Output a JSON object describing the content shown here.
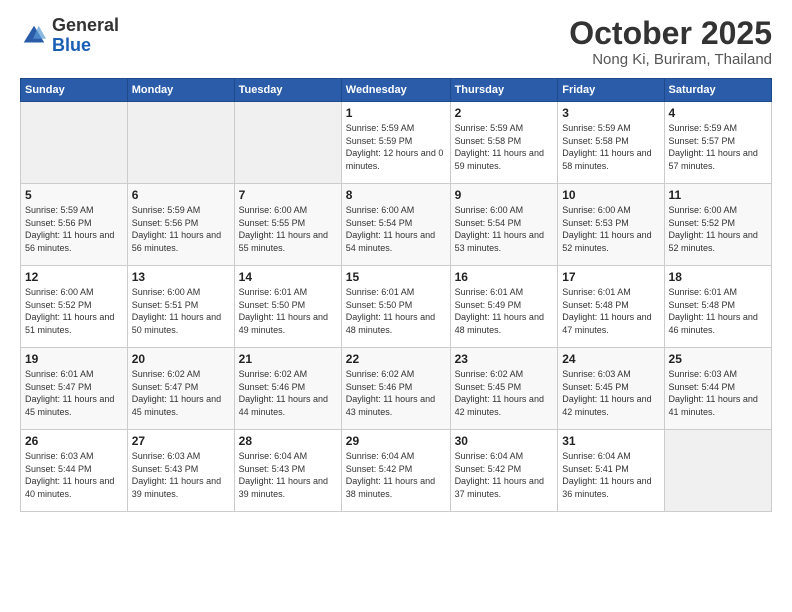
{
  "header": {
    "logo_general": "General",
    "logo_blue": "Blue",
    "month_title": "October 2025",
    "location": "Nong Ki, Buriram, Thailand"
  },
  "weekdays": [
    "Sunday",
    "Monday",
    "Tuesday",
    "Wednesday",
    "Thursday",
    "Friday",
    "Saturday"
  ],
  "weeks": [
    [
      {
        "day": "",
        "sunrise": "",
        "sunset": "",
        "daylight": "",
        "empty": true
      },
      {
        "day": "",
        "sunrise": "",
        "sunset": "",
        "daylight": "",
        "empty": true
      },
      {
        "day": "",
        "sunrise": "",
        "sunset": "",
        "daylight": "",
        "empty": true
      },
      {
        "day": "1",
        "sunrise": "Sunrise: 5:59 AM",
        "sunset": "Sunset: 5:59 PM",
        "daylight": "Daylight: 12 hours and 0 minutes."
      },
      {
        "day": "2",
        "sunrise": "Sunrise: 5:59 AM",
        "sunset": "Sunset: 5:58 PM",
        "daylight": "Daylight: 11 hours and 59 minutes."
      },
      {
        "day": "3",
        "sunrise": "Sunrise: 5:59 AM",
        "sunset": "Sunset: 5:58 PM",
        "daylight": "Daylight: 11 hours and 58 minutes."
      },
      {
        "day": "4",
        "sunrise": "Sunrise: 5:59 AM",
        "sunset": "Sunset: 5:57 PM",
        "daylight": "Daylight: 11 hours and 57 minutes."
      }
    ],
    [
      {
        "day": "5",
        "sunrise": "Sunrise: 5:59 AM",
        "sunset": "Sunset: 5:56 PM",
        "daylight": "Daylight: 11 hours and 56 minutes."
      },
      {
        "day": "6",
        "sunrise": "Sunrise: 5:59 AM",
        "sunset": "Sunset: 5:56 PM",
        "daylight": "Daylight: 11 hours and 56 minutes."
      },
      {
        "day": "7",
        "sunrise": "Sunrise: 6:00 AM",
        "sunset": "Sunset: 5:55 PM",
        "daylight": "Daylight: 11 hours and 55 minutes."
      },
      {
        "day": "8",
        "sunrise": "Sunrise: 6:00 AM",
        "sunset": "Sunset: 5:54 PM",
        "daylight": "Daylight: 11 hours and 54 minutes."
      },
      {
        "day": "9",
        "sunrise": "Sunrise: 6:00 AM",
        "sunset": "Sunset: 5:54 PM",
        "daylight": "Daylight: 11 hours and 53 minutes."
      },
      {
        "day": "10",
        "sunrise": "Sunrise: 6:00 AM",
        "sunset": "Sunset: 5:53 PM",
        "daylight": "Daylight: 11 hours and 52 minutes."
      },
      {
        "day": "11",
        "sunrise": "Sunrise: 6:00 AM",
        "sunset": "Sunset: 5:52 PM",
        "daylight": "Daylight: 11 hours and 52 minutes."
      }
    ],
    [
      {
        "day": "12",
        "sunrise": "Sunrise: 6:00 AM",
        "sunset": "Sunset: 5:52 PM",
        "daylight": "Daylight: 11 hours and 51 minutes."
      },
      {
        "day": "13",
        "sunrise": "Sunrise: 6:00 AM",
        "sunset": "Sunset: 5:51 PM",
        "daylight": "Daylight: 11 hours and 50 minutes."
      },
      {
        "day": "14",
        "sunrise": "Sunrise: 6:01 AM",
        "sunset": "Sunset: 5:50 PM",
        "daylight": "Daylight: 11 hours and 49 minutes."
      },
      {
        "day": "15",
        "sunrise": "Sunrise: 6:01 AM",
        "sunset": "Sunset: 5:50 PM",
        "daylight": "Daylight: 11 hours and 48 minutes."
      },
      {
        "day": "16",
        "sunrise": "Sunrise: 6:01 AM",
        "sunset": "Sunset: 5:49 PM",
        "daylight": "Daylight: 11 hours and 48 minutes."
      },
      {
        "day": "17",
        "sunrise": "Sunrise: 6:01 AM",
        "sunset": "Sunset: 5:48 PM",
        "daylight": "Daylight: 11 hours and 47 minutes."
      },
      {
        "day": "18",
        "sunrise": "Sunrise: 6:01 AM",
        "sunset": "Sunset: 5:48 PM",
        "daylight": "Daylight: 11 hours and 46 minutes."
      }
    ],
    [
      {
        "day": "19",
        "sunrise": "Sunrise: 6:01 AM",
        "sunset": "Sunset: 5:47 PM",
        "daylight": "Daylight: 11 hours and 45 minutes."
      },
      {
        "day": "20",
        "sunrise": "Sunrise: 6:02 AM",
        "sunset": "Sunset: 5:47 PM",
        "daylight": "Daylight: 11 hours and 45 minutes."
      },
      {
        "day": "21",
        "sunrise": "Sunrise: 6:02 AM",
        "sunset": "Sunset: 5:46 PM",
        "daylight": "Daylight: 11 hours and 44 minutes."
      },
      {
        "day": "22",
        "sunrise": "Sunrise: 6:02 AM",
        "sunset": "Sunset: 5:46 PM",
        "daylight": "Daylight: 11 hours and 43 minutes."
      },
      {
        "day": "23",
        "sunrise": "Sunrise: 6:02 AM",
        "sunset": "Sunset: 5:45 PM",
        "daylight": "Daylight: 11 hours and 42 minutes."
      },
      {
        "day": "24",
        "sunrise": "Sunrise: 6:03 AM",
        "sunset": "Sunset: 5:45 PM",
        "daylight": "Daylight: 11 hours and 42 minutes."
      },
      {
        "day": "25",
        "sunrise": "Sunrise: 6:03 AM",
        "sunset": "Sunset: 5:44 PM",
        "daylight": "Daylight: 11 hours and 41 minutes."
      }
    ],
    [
      {
        "day": "26",
        "sunrise": "Sunrise: 6:03 AM",
        "sunset": "Sunset: 5:44 PM",
        "daylight": "Daylight: 11 hours and 40 minutes."
      },
      {
        "day": "27",
        "sunrise": "Sunrise: 6:03 AM",
        "sunset": "Sunset: 5:43 PM",
        "daylight": "Daylight: 11 hours and 39 minutes."
      },
      {
        "day": "28",
        "sunrise": "Sunrise: 6:04 AM",
        "sunset": "Sunset: 5:43 PM",
        "daylight": "Daylight: 11 hours and 39 minutes."
      },
      {
        "day": "29",
        "sunrise": "Sunrise: 6:04 AM",
        "sunset": "Sunset: 5:42 PM",
        "daylight": "Daylight: 11 hours and 38 minutes."
      },
      {
        "day": "30",
        "sunrise": "Sunrise: 6:04 AM",
        "sunset": "Sunset: 5:42 PM",
        "daylight": "Daylight: 11 hours and 37 minutes."
      },
      {
        "day": "31",
        "sunrise": "Sunrise: 6:04 AM",
        "sunset": "Sunset: 5:41 PM",
        "daylight": "Daylight: 11 hours and 36 minutes."
      },
      {
        "day": "",
        "sunrise": "",
        "sunset": "",
        "daylight": "",
        "empty": true
      }
    ]
  ]
}
